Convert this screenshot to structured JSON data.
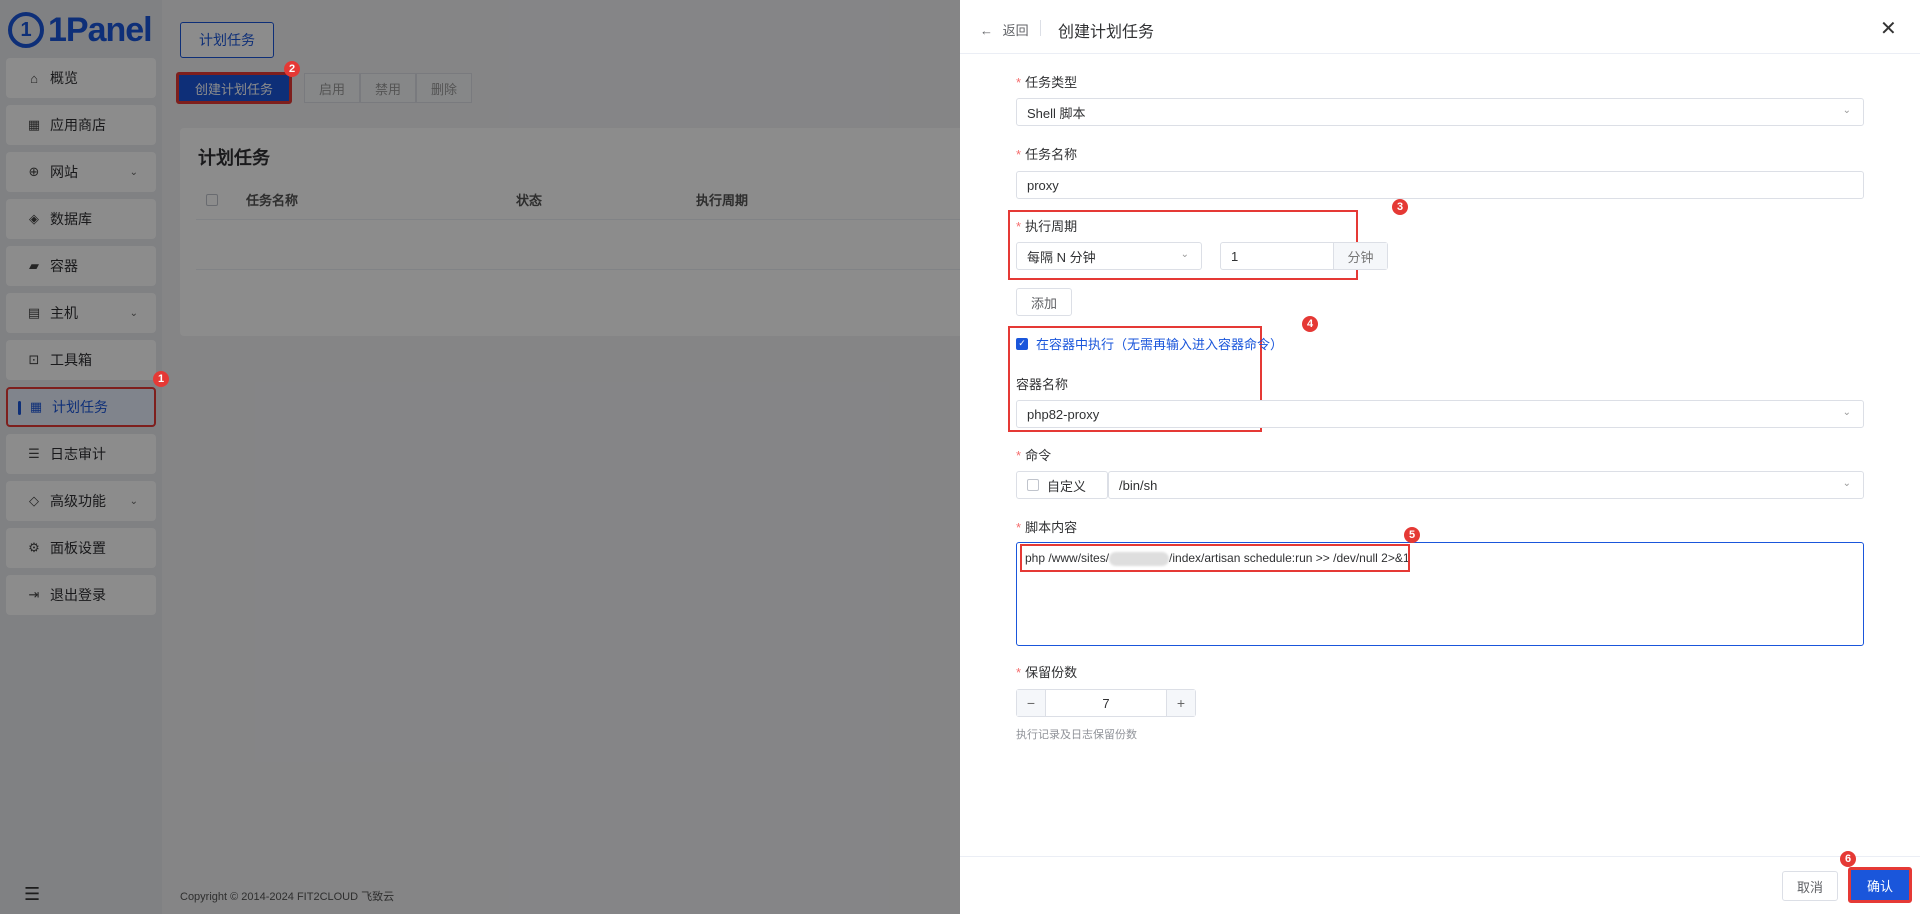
{
  "app": {
    "logo_text": "1Panel",
    "footer": "Copyright © 2014-2024 FIT2CLOUD 飞致云"
  },
  "sidebar": {
    "items": [
      {
        "label": "概览",
        "icon": "home-icon"
      },
      {
        "label": "应用商店",
        "icon": "grid-icon"
      },
      {
        "label": "网站",
        "icon": "globe-icon"
      },
      {
        "label": "数据库",
        "icon": "layers-icon"
      },
      {
        "label": "容器",
        "icon": "docker-icon"
      },
      {
        "label": "主机",
        "icon": "server-icon"
      },
      {
        "label": "工具箱",
        "icon": "toolbox-icon"
      },
      {
        "label": "计划任务",
        "icon": "calendar-icon"
      },
      {
        "label": "日志审计",
        "icon": "log-icon"
      },
      {
        "label": "高级功能",
        "icon": "diamond-icon"
      },
      {
        "label": "面板设置",
        "icon": "gear-icon"
      },
      {
        "label": "退出登录",
        "icon": "logout-icon"
      }
    ]
  },
  "main": {
    "tab": "计划任务",
    "create_button": "创建计划任务",
    "enable_button": "启用",
    "disable_button": "禁用",
    "delete_button": "删除",
    "card_title": "计划任务",
    "columns": [
      "任务名称",
      "状态",
      "执行周期"
    ]
  },
  "drawer": {
    "back": "返回",
    "title": "创建计划任务",
    "task_type_label": "任务类型",
    "task_type_value": "Shell 脚本",
    "task_name_label": "任务名称",
    "task_name_value": "proxy",
    "cycle_label": "执行周期",
    "cycle_type": "每隔 N 分钟",
    "cycle_value": "1",
    "cycle_unit": "分钟",
    "add_button": "添加",
    "in_container_label": "在容器中执行（无需再输入进入容器命令）",
    "container_name_label": "容器名称",
    "container_name_value": "php82-proxy",
    "command_label": "命令",
    "custom_label": "自定义",
    "command_value": "/bin/sh",
    "script_label": "脚本内容",
    "script_prefix": "php /www/sites/",
    "script_suffix": "/index/artisan schedule:run >> /dev/null 2>&1",
    "retain_label": "保留份数",
    "retain_value": "7",
    "retain_hint": "执行记录及日志保留份数",
    "cancel_button": "取消",
    "confirm_button": "确认"
  },
  "annotations": [
    "1",
    "2",
    "3",
    "4",
    "5",
    "6"
  ]
}
